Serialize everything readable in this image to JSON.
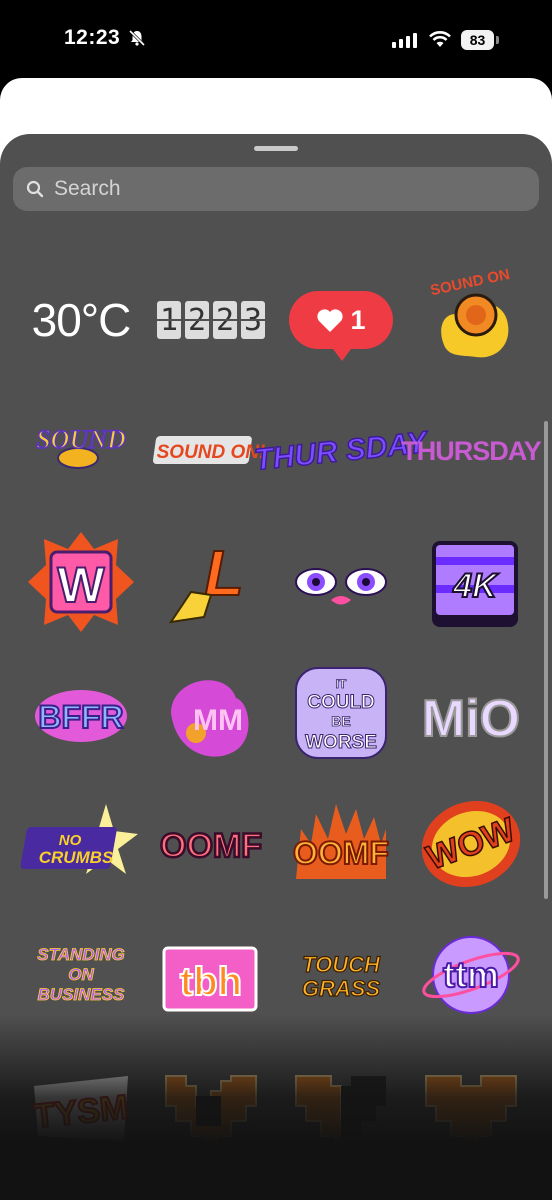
{
  "status_bar": {
    "time": "12:23",
    "battery": "83"
  },
  "search": {
    "placeholder": "Search"
  },
  "stickers": {
    "temperature": "30°C",
    "clock_digits": [
      "1",
      "2",
      "2",
      "3"
    ],
    "like_count": "1",
    "sound_on_1": "SOUND ON",
    "sound_on_2": "SOUND",
    "sound_on_3": "SOUND ON!",
    "thursday_bubble": "THUR SDAY",
    "thursday_text": "THURSDAY",
    "w": "W",
    "l": "L",
    "fourk": "4K",
    "bffr": "BFFR",
    "mm": "MM",
    "it_could_be_worse": [
      "IT",
      "COULD",
      "BE",
      "WORSE"
    ],
    "mio": "MiO",
    "no_crumbs": [
      "NO",
      "CRUMBS"
    ],
    "oomf_pink": "OOMF",
    "oomf_fire": "OOMF",
    "wow": "WOW",
    "standing": [
      "STANDING",
      "ON",
      "BUSINESS"
    ],
    "tbh": "tbh",
    "touch_grass": [
      "TOUCH",
      "GRASS"
    ],
    "ttm": "ttm",
    "tysm": "TYSM"
  }
}
